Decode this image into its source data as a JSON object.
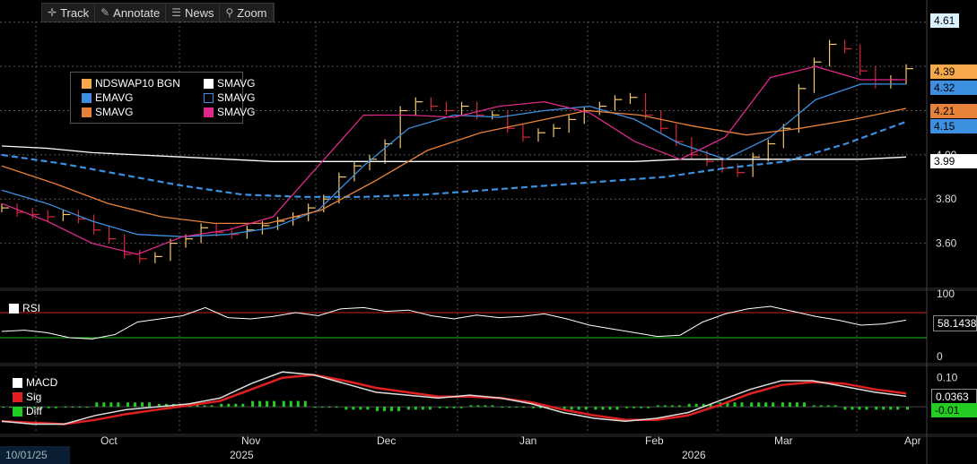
{
  "toolbar": {
    "items": [
      {
        "label": "Track",
        "icon": "crosshair-icon",
        "glyph": "✛"
      },
      {
        "label": "Annotate",
        "icon": "pencil-icon",
        "glyph": "✎"
      },
      {
        "label": "News",
        "icon": "news-icon",
        "glyph": "☰"
      },
      {
        "label": "Zoom",
        "icon": "magnifier-icon",
        "glyph": "⚲"
      }
    ]
  },
  "legend": {
    "entries": [
      {
        "label": "NDSWAP10 BGN",
        "color": "#f6a94a",
        "style": "filled"
      },
      {
        "label": "SMAVG",
        "color": "#ffffff",
        "style": "filled"
      },
      {
        "label": "EMAVG",
        "color": "#3d8fe0",
        "style": "filled"
      },
      {
        "label": "SMAVG",
        "color": "#3d8fe0",
        "style": "dashed-outline"
      },
      {
        "label": "SMAVG",
        "color": "#e8823a",
        "style": "filled"
      },
      {
        "label": "SMAVG",
        "color": "#e0288a",
        "style": "filled"
      }
    ]
  },
  "price_tags": [
    {
      "text": "4.61",
      "value": 4.61,
      "bg": "#d9f2ff",
      "fg": "#000"
    },
    {
      "text": "4.39",
      "value": 4.39,
      "bg": "#f6a94a",
      "fg": "#000"
    },
    {
      "text": "4.32",
      "value": 4.32,
      "bg": "#3d8fe0",
      "fg": "#000"
    },
    {
      "text": "4.21",
      "value": 4.21,
      "bg": "#e8823a",
      "fg": "#000"
    },
    {
      "text": "4.15",
      "value": 4.15,
      "bg": "#3d8fe0",
      "fg": "#000"
    },
    {
      "text": "3.99",
      "value": 3.99,
      "bg": "#ffffff",
      "fg": "#000"
    }
  ],
  "rsi_panel": {
    "label": "RSI",
    "value_text": "58.1438",
    "value": 58.1438,
    "upper": 70,
    "lower": 30,
    "ticks": [
      "100",
      "0"
    ]
  },
  "macd_panel": {
    "legend": [
      {
        "label": "MACD",
        "color": "#ffffff"
      },
      {
        "label": "Sig",
        "color": "#e02020"
      },
      {
        "label": "Diff",
        "color": "#22cc22"
      }
    ],
    "tags": [
      {
        "text": "0.0363",
        "value": 0.0363,
        "bg": "#000",
        "fg": "#fff"
      },
      {
        "text": "-0.01",
        "value": -0.01,
        "bg": "#22cc22",
        "fg": "#000"
      }
    ],
    "ticks": [
      "0.10"
    ]
  },
  "date_box": "10/01/25",
  "chart_data": [
    {
      "type": "line",
      "title": "",
      "series_name_printed": "NDSWAP10 BGN",
      "x_months": [
        "Oct",
        "Nov",
        "Dec",
        "Jan",
        "Feb",
        "Mar",
        "Apr"
      ],
      "x_years": [
        "2025",
        "2026"
      ],
      "y_ticks": [
        "3.60",
        "3.80",
        "3.99",
        "4.00",
        "4.20",
        "4.39",
        "4.60"
      ],
      "ylim": [
        3.42,
        4.66
      ],
      "series": [
        {
          "name": "NDSWAP10 BGN",
          "color": "#f6a94a",
          "values": [
            3.76,
            3.74,
            3.73,
            3.72,
            3.73,
            3.71,
            3.66,
            3.62,
            3.55,
            3.53,
            3.54,
            3.6,
            3.62,
            3.67,
            3.65,
            3.64,
            3.66,
            3.68,
            3.7,
            3.72,
            3.76,
            3.8,
            3.9,
            3.95,
            3.98,
            4.05,
            4.2,
            4.24,
            4.22,
            4.2,
            4.22,
            4.18,
            4.18,
            4.12,
            4.08,
            4.1,
            4.12,
            4.16,
            4.2,
            4.22,
            4.25,
            4.26,
            4.18,
            4.12,
            4.06,
            4.0,
            3.97,
            3.94,
            3.92,
            3.99,
            4.05,
            4.12,
            4.3,
            4.42,
            4.5,
            4.48,
            4.38,
            4.32,
            4.34,
            4.39
          ]
        },
        {
          "name": "SMAVG",
          "color": "#ffffff",
          "values": [
            4.04,
            4.03,
            4.01,
            4.0,
            3.99,
            3.98,
            3.97,
            3.97,
            3.97,
            3.97,
            3.97,
            3.97,
            3.97,
            3.97,
            3.97,
            3.98,
            3.98,
            3.98,
            3.98,
            3.98,
            3.99
          ]
        },
        {
          "name": "EMAVG",
          "color": "#3d8fe0",
          "values": [
            3.84,
            3.78,
            3.7,
            3.64,
            3.63,
            3.64,
            3.67,
            3.75,
            3.95,
            4.12,
            4.18,
            4.17,
            4.2,
            4.22,
            4.16,
            4.05,
            3.98,
            4.08,
            4.25,
            4.32,
            4.32
          ]
        },
        {
          "name": "SMAVG",
          "color": "#3d8fe0",
          "dashed": true,
          "values": [
            4.0,
            3.96,
            3.91,
            3.86,
            3.82,
            3.81,
            3.81,
            3.82,
            3.84,
            3.86,
            3.88,
            3.9,
            3.94,
            3.97,
            4.05,
            4.15
          ]
        },
        {
          "name": "SMAVG",
          "color": "#e8823a",
          "values": [
            3.95,
            3.87,
            3.78,
            3.72,
            3.69,
            3.69,
            3.75,
            3.88,
            4.02,
            4.1,
            4.15,
            4.2,
            4.18,
            4.13,
            4.09,
            4.12,
            4.16,
            4.21
          ]
        },
        {
          "name": "SMAVG",
          "color": "#e0288a",
          "values": [
            3.78,
            3.7,
            3.6,
            3.55,
            3.63,
            3.66,
            3.72,
            3.95,
            4.18,
            4.18,
            4.17,
            4.22,
            4.24,
            4.19,
            4.06,
            3.98,
            4.08,
            4.35,
            4.4,
            4.34,
            4.34
          ]
        }
      ]
    },
    {
      "type": "line",
      "title": "",
      "series_name_printed": "RSI",
      "ylim": [
        0,
        100
      ],
      "series": [
        {
          "name": "RSI",
          "color": "#ffffff",
          "values": [
            40,
            42,
            38,
            30,
            28,
            35,
            55,
            60,
            65,
            78,
            62,
            60,
            64,
            70,
            65,
            76,
            78,
            72,
            74,
            65,
            60,
            66,
            62,
            64,
            68,
            60,
            50,
            44,
            38,
            32,
            34,
            55,
            68,
            76,
            80,
            72,
            64,
            58,
            50,
            52,
            58
          ]
        }
      ]
    },
    {
      "type": "line",
      "title": "",
      "series_name_printed": "MACD",
      "ylim": [
        -0.08,
        0.13
      ],
      "series": [
        {
          "name": "MACD",
          "color": "#ffffff",
          "values": [
            -0.05,
            -0.06,
            -0.06,
            -0.03,
            -0.01,
            0.0,
            0.01,
            0.03,
            0.08,
            0.12,
            0.11,
            0.08,
            0.05,
            0.04,
            0.03,
            0.04,
            0.03,
            0.01,
            -0.02,
            -0.04,
            -0.05,
            -0.04,
            -0.02,
            0.02,
            0.06,
            0.09,
            0.09,
            0.07,
            0.05,
            0.036
          ]
        },
        {
          "name": "Sig",
          "color": "#e02020",
          "values": [
            -0.05,
            -0.055,
            -0.06,
            -0.045,
            -0.025,
            -0.01,
            0.005,
            0.02,
            0.06,
            0.1,
            0.11,
            0.09,
            0.065,
            0.05,
            0.035,
            0.035,
            0.03,
            0.015,
            -0.01,
            -0.03,
            -0.045,
            -0.045,
            -0.03,
            0.005,
            0.045,
            0.075,
            0.085,
            0.08,
            0.06,
            0.046
          ]
        },
        {
          "name": "Diff",
          "color": "#22cc22",
          "values": [
            0.0,
            -0.005,
            0.0,
            0.015,
            0.015,
            0.01,
            0.005,
            0.01,
            0.02,
            0.02,
            0.0,
            -0.01,
            -0.015,
            -0.01,
            -0.005,
            0.005,
            0.0,
            -0.005,
            -0.01,
            -0.01,
            -0.005,
            0.005,
            0.01,
            0.015,
            0.015,
            0.015,
            0.005,
            -0.01,
            -0.01,
            -0.01
          ]
        }
      ]
    }
  ]
}
